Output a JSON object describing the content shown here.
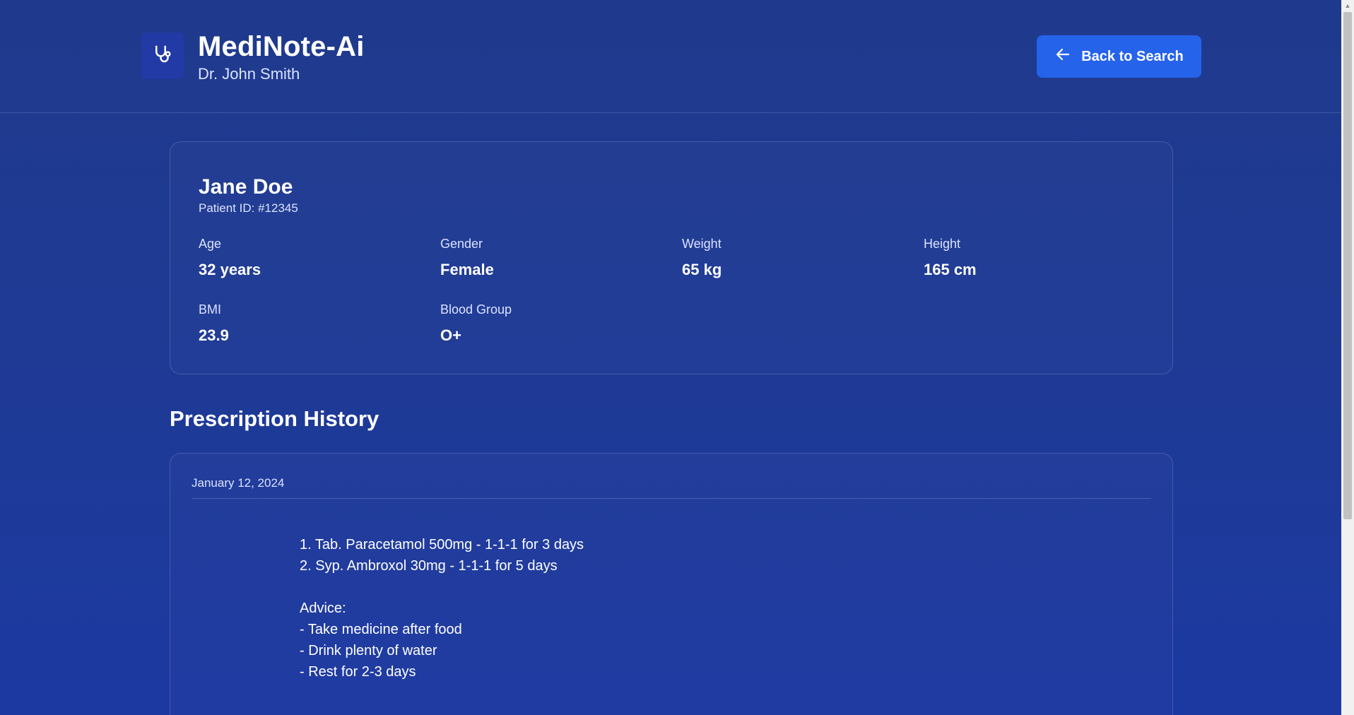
{
  "header": {
    "app_title": "MediNote-Ai",
    "doctor_name": "Dr. John Smith",
    "logo_icon": "stethoscope-icon",
    "back_button_label": "Back to Search",
    "back_button_icon": "arrow-left-icon"
  },
  "patient": {
    "name": "Jane Doe",
    "patient_id": "Patient ID: #12345",
    "stats": [
      {
        "label": "Age",
        "value": "32 years"
      },
      {
        "label": "Gender",
        "value": "Female"
      },
      {
        "label": "Weight",
        "value": "65 kg"
      },
      {
        "label": "Height",
        "value": "165 cm"
      },
      {
        "label": "BMI",
        "value": "23.9"
      },
      {
        "label": "Blood Group",
        "value": "O+"
      }
    ]
  },
  "prescription_history": {
    "title": "Prescription History",
    "entries": [
      {
        "date": "January 12, 2024",
        "lines": [
          "1. Tab. Paracetamol 500mg - 1-1-1 for 3 days",
          "2. Syp. Ambroxol 30mg - 1-1-1 for 5 days",
          "",
          "Advice:",
          "- Take medicine after food",
          "- Drink plenty of water",
          "- Rest for 2-3 days"
        ]
      }
    ]
  },
  "colors": {
    "background": "#1f3a8c",
    "button": "#2563eb",
    "muted_text": "#dbe3ff"
  }
}
